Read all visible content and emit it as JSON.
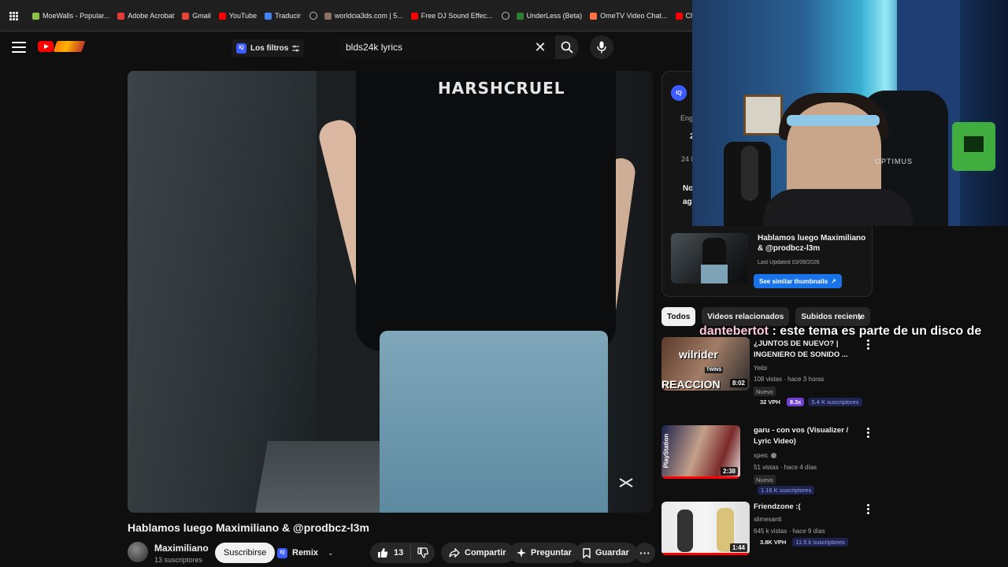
{
  "bookmarks": [
    {
      "label": "MoeWalls - Popular...",
      "color": "#8bc34a"
    },
    {
      "label": "Adobe Acrobat",
      "color": "#e53935"
    },
    {
      "label": "Gmail",
      "color": "#ea4335"
    },
    {
      "label": "YouTube",
      "color": "#ff0000"
    },
    {
      "label": "Traducir",
      "color": "#4285f4"
    },
    {
      "label": "worldcia3ds.com | 5...",
      "color": "#8d6e63"
    },
    {
      "label": "Free DJ Sound Effec...",
      "color": "#ff0000"
    },
    {
      "label": "UnderLess (Beta)",
      "color": "#2e7d32"
    },
    {
      "label": "OmeTV Video Chat...",
      "color": "#ff7043"
    },
    {
      "label": "Cha",
      "color": "#ff0000"
    }
  ],
  "masthead": {
    "filters_label": "Los filtros",
    "search_value": "blds24k lyrics"
  },
  "player": {
    "shirt_text": "HARSHCRUEL"
  },
  "video": {
    "title": "Hablamos luego Maximiliano & @prodbcz-l3m",
    "channel": "Maximiliano",
    "subscribers": "13 suscriptores",
    "subscribe_label": "Suscribirse",
    "remix_label": "Remix",
    "likes": "13",
    "share_label": "Compartir",
    "ask_label": "Preguntar",
    "save_label": "Guardar"
  },
  "extension": {
    "frag1": "Eng",
    "frag2": "2",
    "frag3": "24 I",
    "frag4": "No",
    "frag5": "ag",
    "card_title": "Hablamos luego Maximiliano & @prodbcz-l3m",
    "updated": "Last Updated 03/09/2026",
    "similar_label": "See similar thumbnails"
  },
  "webcam": {
    "brand": "OPTIMUS"
  },
  "chips": [
    "Todos",
    "Videos relacionados",
    "Subidos reciente"
  ],
  "chat": {
    "user": "dantebertot",
    "message": " : este tema es parte de un disco de"
  },
  "recommendations": [
    {
      "title": "¿JUNTOS DE NUEVO? | INGENIERO DE SONIDO ...",
      "channel": "Yeibi",
      "meta": "108 vistas · hace 3 horas",
      "badge": "Nuevo",
      "duration": "8:02",
      "thumb_text1": "wilrider",
      "thumb_text2": "REACCION",
      "thumb_text3": "TWINS",
      "vph": "32 VPH",
      "multiplier": "8.3x",
      "subs": "5.4 K suscriptores"
    },
    {
      "title": "garu - con vos (Visualizer / Lyric Video)",
      "channel": "xpeic",
      "meta": "51 vistas · hace 4 días",
      "badge": "Nuevo",
      "duration": "2:38",
      "thumb_text1": "PlayStation",
      "subs": "1.16 K suscriptores"
    },
    {
      "title": "Friendzone :(",
      "channel": "slimesanti",
      "meta": "645 k vistas · hace 9 días",
      "duration": "1:44",
      "vph": "3.8K VPH",
      "subs": "11.5 k suscriptores"
    }
  ],
  "colors": {
    "accent": "#ff0000",
    "iq_blue": "#3d5cff",
    "similar_blue": "#1a73e8",
    "multiplier_purple": "#6f3fd6"
  }
}
